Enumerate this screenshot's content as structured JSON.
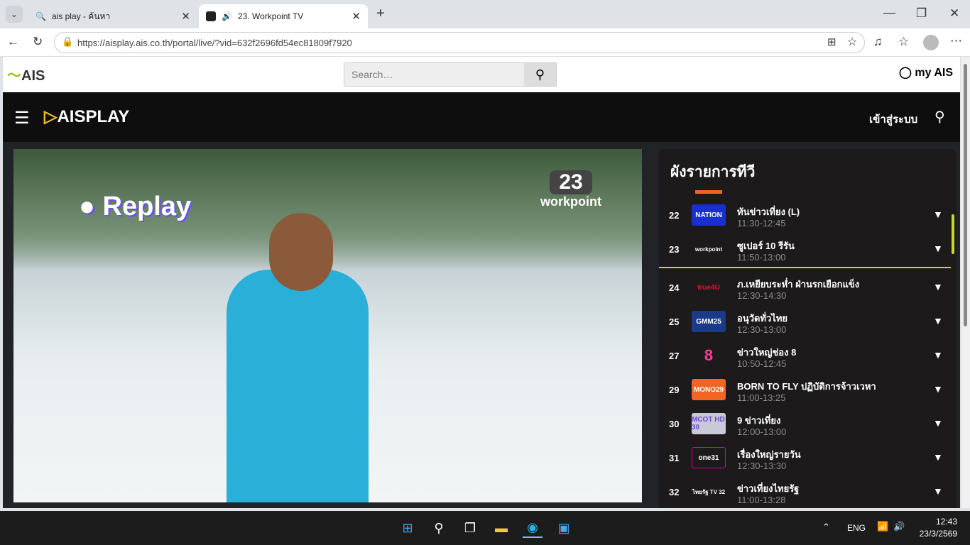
{
  "browser": {
    "tabs": [
      {
        "label": "ais play - ค้นหา"
      },
      {
        "label": "23. Workpoint TV"
      }
    ],
    "url": "https://aisplay.ais.co.th/portal/live/?vid=632f2696fd54ec81809f7920"
  },
  "site": {
    "brand": "AIS",
    "search_placeholder": "Search…",
    "my_ais": "my AIS",
    "app_brand": "AISPLAY",
    "login": "เข้าสู่ระบบ"
  },
  "video": {
    "badge": "Replay",
    "channel_num": "23",
    "channel_name": "workpoint"
  },
  "guide": {
    "title": "ผังรายการทีวี",
    "accent": "#c6d92b",
    "rows": [
      {
        "num": "22",
        "logo": "NATION",
        "title": "ทันข่าวเที่ยง (L)",
        "time": "11:30-12:45"
      },
      {
        "num": "23",
        "logo": "workpoint",
        "title": "ซูเปอร์ 10 รีรัน",
        "time": "11:50-13:00"
      },
      {
        "num": "24",
        "logo": "true4U",
        "title": "ภ.เหยียบระห่ำ ฝ่านรกเยือกแข็ง",
        "time": "12:30-14:30"
      },
      {
        "num": "25",
        "logo": "GMM25",
        "title": "อนุวัดทั่วไทย",
        "time": "12:30-13:00"
      },
      {
        "num": "27",
        "logo": "8",
        "title": "ข่าวใหญ่ช่อง 8",
        "time": "10:50-12:45"
      },
      {
        "num": "29",
        "logo": "MONO29",
        "title": "BORN TO FLY ปฏิบัติการจ้าวเวหา",
        "time": "11:00-13:25"
      },
      {
        "num": "30",
        "logo": "MCOT HD 30",
        "title": "9 ข่าวเที่ยง",
        "time": "12:00-13:00"
      },
      {
        "num": "31",
        "logo": "one31",
        "title": "เรื่องใหญ่รายวัน",
        "time": "12:30-13:30"
      },
      {
        "num": "32",
        "logo": "ไทยรัฐ TV 32",
        "title": "ข่าวเที่ยงไทยรัฐ",
        "time": "11:00-13:28"
      }
    ]
  },
  "taskbar": {
    "lang": "ENG",
    "time": "12:43",
    "date": "23/3/2569"
  }
}
